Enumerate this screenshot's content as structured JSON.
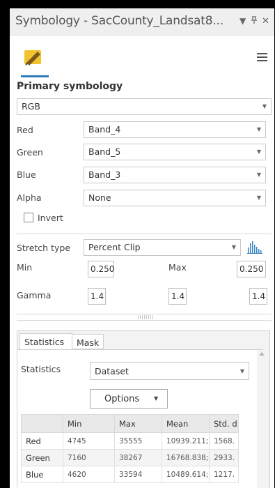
{
  "window": {
    "title": "Symbology - SacCounty_Landsat8...",
    "pin_glyph": "▾ ٢ ✕"
  },
  "symbology": {
    "section_title": "Primary symbology",
    "renderer": "RGB",
    "bands": [
      {
        "label": "Red",
        "value": "Band_4"
      },
      {
        "label": "Green",
        "value": "Band_5"
      },
      {
        "label": "Blue",
        "value": "Band_3"
      },
      {
        "label": "Alpha",
        "value": "None"
      }
    ],
    "invert_label": "Invert",
    "invert_checked": false,
    "stretch_type_label": "Stretch type",
    "stretch_type_value": "Percent Clip",
    "min_label": "Min",
    "min_value": "0.250",
    "max_label": "Max",
    "max_value": "0.250",
    "gamma_label": "Gamma",
    "gamma_values": [
      "1.4",
      "1.4",
      "1.4"
    ]
  },
  "tabs": [
    {
      "label": "Statistics",
      "active": true
    },
    {
      "label": "Mask",
      "active": false
    }
  ],
  "statistics": {
    "label": "Statistics",
    "source": "Dataset",
    "options_label": "Options",
    "columns": [
      "",
      "Min",
      "Max",
      "Mean",
      "Std. d"
    ],
    "rows": [
      {
        "band": "Red",
        "min": "4745",
        "max": "35555",
        "mean": "10939.211;",
        "std": "1568."
      },
      {
        "band": "Green",
        "min": "7160",
        "max": "38267",
        "mean": "16768.838;",
        "std": "2933."
      },
      {
        "band": "Blue",
        "min": "4620",
        "max": "33594",
        "mean": "10489.614;",
        "std": "1217."
      }
    ]
  },
  "colors": {
    "accent": "#2f7bb8",
    "histogram_icon": "#3b82c4",
    "pencil_icon": "#e8b21c"
  },
  "icons": [
    "symbology-pencil-icon",
    "hamburger-menu-icon",
    "histogram-icon",
    "dropdown-arrow-icon"
  ]
}
